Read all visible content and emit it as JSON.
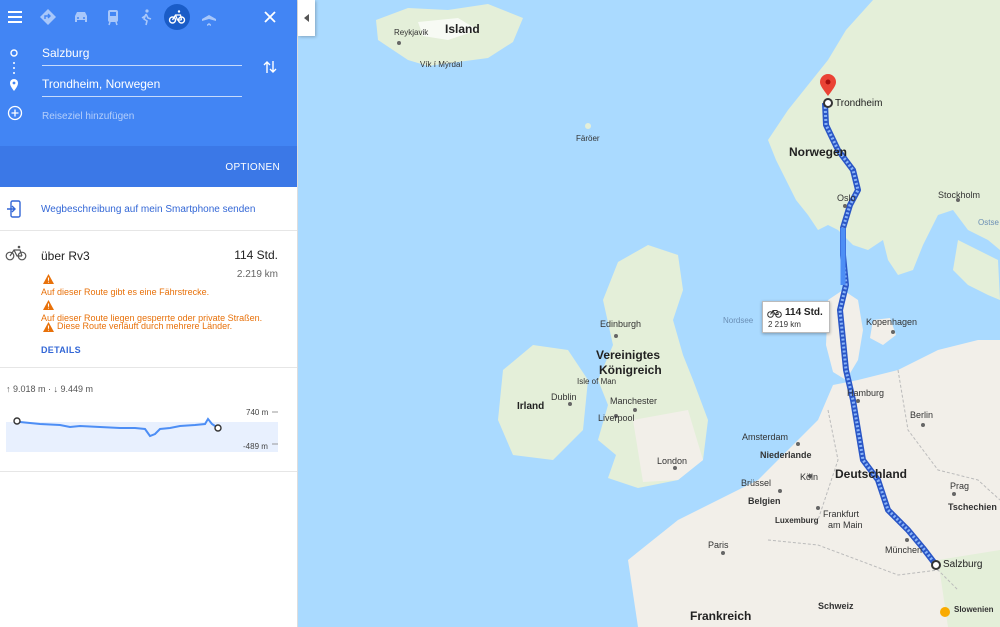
{
  "modes": [
    {
      "name": "menu"
    },
    {
      "name": "best"
    },
    {
      "name": "car"
    },
    {
      "name": "transit"
    },
    {
      "name": "walk"
    },
    {
      "name": "bicycle",
      "active": true
    },
    {
      "name": "flight"
    }
  ],
  "route": {
    "origin": "Salzburg",
    "destination": "Trondheim, Norwegen",
    "add_stop": "Reiseziel hinzufügen",
    "options": "OPTIONEN"
  },
  "send_to_phone": "Wegbeschreibung auf mein Smartphone senden",
  "result": {
    "via": "über Rv3",
    "duration": "114 Std.",
    "distance": "2.219 km",
    "warnings": [
      "Auf dieser Route gibt es eine Fährstrecke.",
      "Auf dieser Route liegen gesperrte oder private Straßen.",
      "Diese Route verläuft durch mehrere Länder."
    ],
    "details": "DETAILS"
  },
  "elevation": {
    "summary": "↑ 9.018 m · ↓ 9.449 m",
    "max_label": "740 m",
    "min_label": "-489 m"
  },
  "map": {
    "labels": {
      "island": "Island",
      "reykjavik": "Reykjavik",
      "vik": "Vík í Mýrdal",
      "faroer": "Färöer",
      "norwegen": "Norwegen",
      "trondheim": "Trondheim",
      "oslo": "Oslo",
      "stockholm": "Stockholm",
      "ostsee": "Ostse",
      "nordsee": "Nordsee",
      "kopenhagen": "Kopenhagen",
      "edinburgh": "Edinburgh",
      "vereinigtes1": "Vereinigtes",
      "vereinigtes2": "Königreich",
      "isleofman": "Isle of Man",
      "irland": "Irland",
      "dublin": "Dublin",
      "manchester": "Manchester",
      "liverpool": "Liverpool",
      "london": "London",
      "hamburg": "Hamburg",
      "berlin": "Berlin",
      "amsterdam": "Amsterdam",
      "niederlande": "Niederlande",
      "deutschland": "Deutschland",
      "koeln": "Köln",
      "bruessel": "Brüssel",
      "belgien": "Belgien",
      "luxemburg": "Luxemburg",
      "frankfurt1": "Frankfurt",
      "frankfurt2": "am Main",
      "paris": "Paris",
      "prag": "Prag",
      "tschechien": "Tschechien",
      "muenchen": "München",
      "salzburg": "Salzburg",
      "schweiz": "Schweiz",
      "slowenien": "Slowenien",
      "frankreich": "Frankreich"
    },
    "duration_box": {
      "time": "114 Std.",
      "distance": "2 219 km"
    }
  },
  "colors": {
    "accent": "#4285f4",
    "route": "#4d8ef5",
    "warning": "#e8710a",
    "sea": "#aadaff",
    "land": "#f2efe9"
  }
}
